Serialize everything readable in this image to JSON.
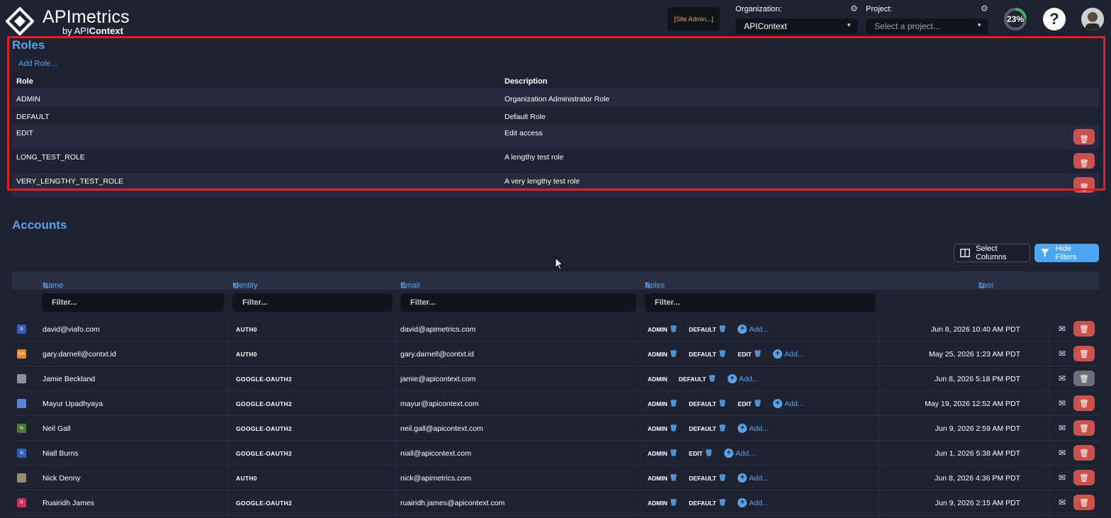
{
  "header": {
    "brand": "APImetrics",
    "brand_by": "by API",
    "brand_by_bold": "Context",
    "site_admin_label": "[Site Admin...]",
    "organization_label": "Organization:",
    "organization_value": "APIContext",
    "project_label": "Project:",
    "project_placeholder": "Select a project...",
    "progress_percent": 23,
    "progress_text": "23%",
    "help_label": "?"
  },
  "roles": {
    "title": "Roles",
    "add_label": "Add Role...",
    "columns": [
      "Role",
      "Description"
    ],
    "rows": [
      {
        "role": "ADMIN",
        "description": "Organization Administrator Role",
        "deletable": false
      },
      {
        "role": "DEFAULT",
        "description": "Default Role",
        "deletable": false
      },
      {
        "role": "EDIT",
        "description": "Edit access",
        "deletable": true
      },
      {
        "role": "LONG_TEST_ROLE",
        "description": "A lengthy test role",
        "deletable": true
      },
      {
        "role": "VERY_LENGTHY_TEST_ROLE",
        "description": "A very lengthy test role",
        "deletable": true
      }
    ]
  },
  "accounts": {
    "title": "Accounts",
    "select_columns_label": "Select Columns",
    "hide_filters_label": "Hide Filters",
    "columns": {
      "name": "Name",
      "provider": "Identity Provider",
      "email": "Email",
      "roles": "Roles",
      "last_login": "Last Login"
    },
    "filter_placeholder": "Filter...",
    "add_role_label": "Add...",
    "rows": [
      {
        "avatar": "G",
        "avatar_color": "#3b5fb0",
        "name": "david@viafo.com",
        "provider": "AUTH0",
        "email": "david@apimetrics.com",
        "roles": [
          "ADMIN",
          "DEFAULT"
        ],
        "last_login": "Jun 8, 2026 10:40 AM PDT",
        "delete_enabled": true
      },
      {
        "avatar": "GA",
        "avatar_color": "#e08a2e",
        "name": "gary.darnell@contxt.id",
        "provider": "AUTH0",
        "email": "gary.darnell@contxt.id",
        "roles": [
          "ADMIN",
          "DEFAULT",
          "EDIT"
        ],
        "last_login": "May 25, 2026 1:23 AM PDT",
        "delete_enabled": true
      },
      {
        "avatar": "",
        "avatar_color": "#8a8f99",
        "name": "Jamie Beckland",
        "provider": "GOOGLE-OAUTH2",
        "email": "jamie@apicontext.com",
        "roles": [
          "ADMIN",
          "DEFAULT"
        ],
        "last_login": "Jun 8, 2026 5:18 PM PDT",
        "delete_enabled": false
      },
      {
        "avatar": "",
        "avatar_color": "#5b86d6",
        "name": "Mayur Upadhyaya",
        "provider": "GOOGLE-OAUTH2",
        "email": "mayur@apicontext.com",
        "roles": [
          "ADMIN",
          "DEFAULT",
          "EDIT"
        ],
        "last_login": "May 19, 2026 12:52 AM PDT",
        "delete_enabled": true
      },
      {
        "avatar": "N",
        "avatar_color": "#4f7a35",
        "name": "Neil Gall",
        "provider": "GOOGLE-OAUTH2",
        "email": "neil.gall@apicontext.com",
        "roles": [
          "ADMIN",
          "DEFAULT"
        ],
        "last_login": "Jun 9, 2026 2:59 AM PDT",
        "delete_enabled": true
      },
      {
        "avatar": "N",
        "avatar_color": "#2e62b8",
        "name": "Niall Burns",
        "provider": "GOOGLE-OAUTH2",
        "email": "niall@apicontext.com",
        "roles": [
          "ADMIN",
          "EDIT"
        ],
        "last_login": "Jun 1, 2026 5:38 AM PDT",
        "delete_enabled": true
      },
      {
        "avatar": "",
        "avatar_color": "#9c8a78",
        "name": "Nick Denny",
        "provider": "AUTH0",
        "email": "nick@apimetrics.com",
        "roles": [
          "ADMIN",
          "DEFAULT"
        ],
        "last_login": "Jun 8, 2026 4:36 PM PDT",
        "delete_enabled": true
      },
      {
        "avatar": "R",
        "avatar_color": "#c2335f",
        "name": "Ruairidh James",
        "provider": "GOOGLE-OAUTH2",
        "email": "ruairidh.james@apicontext.com",
        "roles": [
          "ADMIN",
          "DEFAULT"
        ],
        "last_login": "Jun 9, 2026 2:15 AM PDT",
        "delete_enabled": true
      }
    ]
  },
  "colors": {
    "background": "#1f2232",
    "accent": "#5aa3e6",
    "danger": "#c9524e",
    "highlight_border": "#d5252b"
  }
}
